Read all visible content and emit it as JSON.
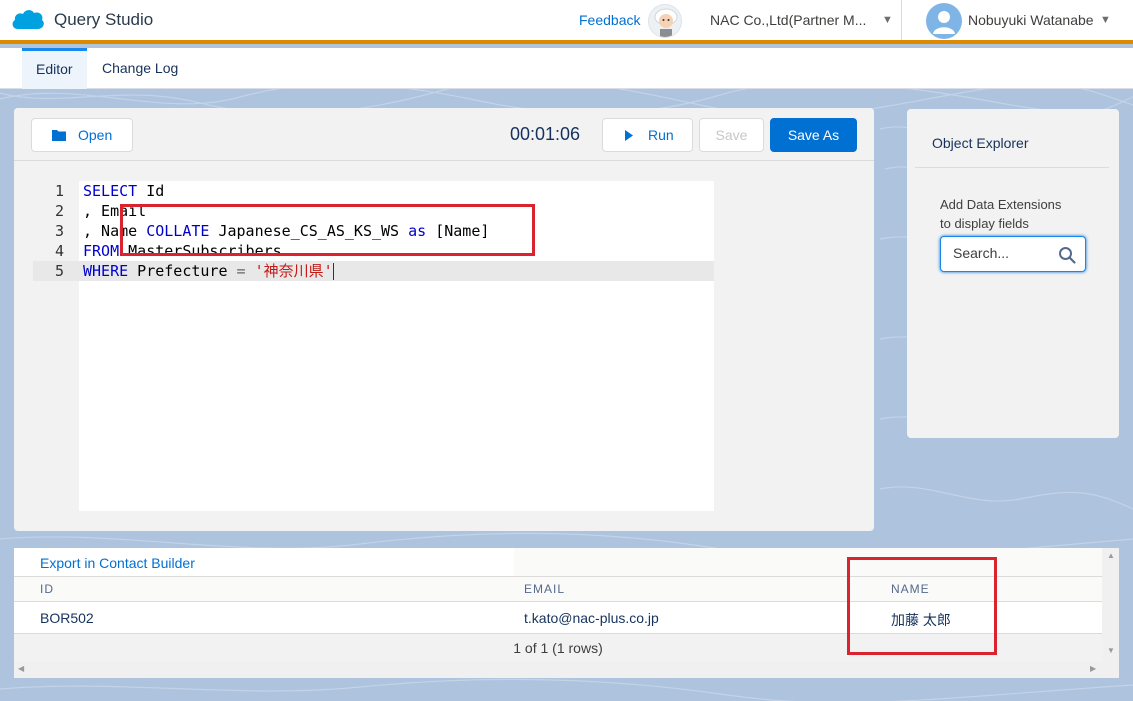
{
  "header": {
    "app_title": "Query Studio",
    "feedback_label": "Feedback",
    "org_name": "NAC Co.,Ltd(Partner M...",
    "user_name": "Nobuyuki Watanabe",
    "icons": [
      "salesforce-cloud-logo",
      "einstein-avatar",
      "chevron-down-icon",
      "user-avatar-icon"
    ]
  },
  "tabs": [
    {
      "label": "Editor",
      "active": true
    },
    {
      "label": "Change Log",
      "active": false
    }
  ],
  "toolbar": {
    "open_label": "Open",
    "timer": "00:01:06",
    "run_label": "Run",
    "save_label": "Save",
    "save_as_label": "Save As"
  },
  "editor": {
    "line_numbers": [
      "1",
      "2",
      "3",
      "4",
      "5"
    ],
    "lines": [
      [
        {
          "t": "SELECT",
          "k": "kw"
        },
        {
          "t": " Id",
          "k": ""
        }
      ],
      [
        {
          "t": ", Email",
          "k": ""
        }
      ],
      [
        {
          "t": ", Name ",
          "k": ""
        },
        {
          "t": "COLLATE",
          "k": "kw"
        },
        {
          "t": " Japanese_CS_AS_KS_WS ",
          "k": ""
        },
        {
          "t": "as",
          "k": "kw"
        },
        {
          "t": " [Name]",
          "k": ""
        }
      ],
      [
        {
          "t": "FROM",
          "k": "kw"
        },
        {
          "t": " MasterSubscribers",
          "k": ""
        }
      ],
      [
        {
          "t": "WHERE",
          "k": "kw"
        },
        {
          "t": " Prefecture ",
          "k": ""
        },
        {
          "t": "=",
          "k": "op"
        },
        {
          "t": " ",
          "k": ""
        },
        {
          "t": "'神奈川県'",
          "k": "str"
        }
      ]
    ],
    "active_line": 5
  },
  "explorer": {
    "title": "Object Explorer",
    "hint_line1": "Add Data Extensions",
    "hint_line2": "to display fields",
    "search_placeholder": "Search..."
  },
  "results": {
    "export_label": "Export in Contact Builder",
    "columns": [
      "ID",
      "EMAIL",
      "NAME"
    ],
    "rows": [
      [
        "BOR502",
        "t.kato@nac-plus.co.jp",
        "加藤 太郎"
      ]
    ],
    "footer": "1 of 1 (1 rows)"
  },
  "colors": {
    "brand_blue": "#0070d2",
    "accent_orange": "#dd8a00",
    "highlight_red": "#d9232e",
    "background": "#b0c4de"
  }
}
